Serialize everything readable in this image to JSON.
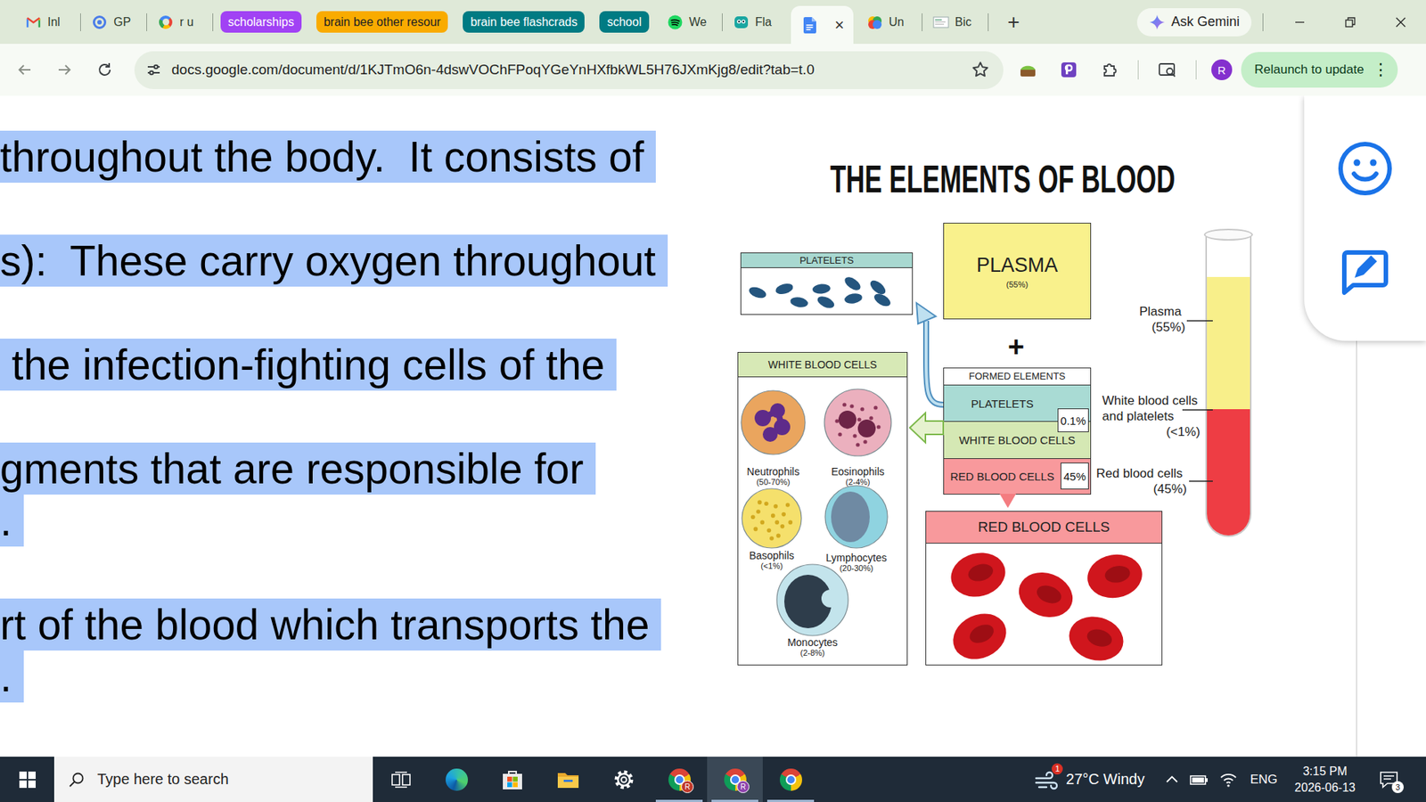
{
  "browser": {
    "tabs": [
      {
        "kind": "tab",
        "label": "Inl",
        "selected": false
      },
      {
        "kind": "tab",
        "label": "GP",
        "selected": false
      },
      {
        "kind": "tab",
        "label": "r u",
        "selected": false
      },
      {
        "kind": "group",
        "label": "scholarships",
        "color": "#a142f4"
      },
      {
        "kind": "group",
        "label": "brain bee other resour",
        "color": "#f9ab00"
      },
      {
        "kind": "group",
        "label": "brain bee flashcrads",
        "color": "#007b83"
      },
      {
        "kind": "group",
        "label": "school",
        "color": "#007b83"
      },
      {
        "kind": "tab",
        "label": "We",
        "selected": false
      },
      {
        "kind": "tab",
        "label": "Fla",
        "selected": false
      },
      {
        "kind": "tab",
        "close": "×",
        "selected": true
      },
      {
        "kind": "tab",
        "label": "Un",
        "selected": false
      },
      {
        "kind": "tab",
        "label": "Bic",
        "selected": false
      }
    ],
    "new_tab": "+",
    "gemini": "Ask Gemini",
    "url": "docs.google.com/document/d/1KJTmO6n-4dswVOChFPoqYGeYnHXfbkWL5H76JXmKjg8/edit?tab=t.0",
    "bookmarked": false,
    "profile": "R",
    "relaunch": "Relaunch to update",
    "menu": "⋮"
  },
  "doc": {
    "selected": true,
    "lines": [
      {
        "text": "throughout the body.  It consists of",
        "kind": "start"
      },
      {
        "text": "s):  These carry oxygen throughout",
        "kind": "start"
      },
      {
        "text": " the infection-fighting cells of the",
        "kind": "start"
      },
      {
        "text": "gments that are responsible for",
        "kind": "start"
      },
      {
        "text": ".",
        "kind": "wrap"
      },
      {
        "text": "rt of the blood which transports the",
        "kind": "start"
      },
      {
        "text": ".",
        "kind": "wrap"
      }
    ]
  },
  "diagram": {
    "title": "THE ELEMENTS OF BLOOD",
    "platelets": {
      "header": "PLATELETS"
    },
    "plasma": {
      "label": "PLASMA",
      "percent": "(55%)"
    },
    "plus": "+",
    "formed": {
      "header": "FORMED ELEMENTS",
      "rows": [
        {
          "label": "PLATELETS",
          "badge": "0.1%",
          "color": "#a9dbd4"
        },
        {
          "label": "WHITE BLOOD CELLS",
          "badge": "",
          "color": "#d5e8b4"
        },
        {
          "label": "RED BLOOD CELLS",
          "badge": "45%",
          "color": "#f8999c"
        }
      ]
    },
    "wbc": {
      "header": "WHITE BLOOD CELLS",
      "cells": [
        {
          "name": "Neutrophils",
          "percent": "(50-70%)",
          "color": "#eaa55e"
        },
        {
          "name": "Eosinophils",
          "percent": "(2-4%)",
          "color": "#ebb0be"
        },
        {
          "name": "Basophils",
          "percent": "(<1%)",
          "color": "#f5e06c"
        },
        {
          "name": "Lymphocytes",
          "percent": "(20-30%)",
          "color": "#8fd3e0"
        },
        {
          "name": "Monocytes",
          "percent": "(2-8%)",
          "color": "#c3e4ec"
        }
      ]
    },
    "rbc": {
      "header": "RED BLOOD CELLS"
    },
    "tube": {
      "layers": [
        {
          "color": "#f8ef8a",
          "level": 0.44
        },
        {
          "color": "#ee3d44",
          "level": 0.42
        }
      ],
      "labels": [
        {
          "lines": [
            "Plasma",
            "(55%)"
          ]
        },
        {
          "lines": [
            "White blood cells",
            "and platelets",
            "(<1%)"
          ]
        },
        {
          "lines": [
            "Red blood cells",
            "(45%)"
          ]
        }
      ]
    }
  },
  "taskbar": {
    "search": "Type here to search",
    "apps": [
      {
        "badge": "",
        "running": false,
        "selected": false
      },
      {
        "badge": "",
        "running": false,
        "selected": false
      },
      {
        "badge": "",
        "running": false,
        "selected": false
      },
      {
        "badge": "",
        "running": false,
        "selected": false
      },
      {
        "badge": "",
        "running": false,
        "selected": false
      },
      {
        "badge": "R",
        "running": true,
        "selected": false,
        "color": "#c0392b"
      },
      {
        "badge": "R",
        "running": true,
        "selected": true,
        "color": "#8e44ad"
      },
      {
        "badge": "",
        "running": true,
        "selected": false
      }
    ],
    "weather_badge": "1",
    "weather": "27°C Windy",
    "language": "ENG",
    "time": "3:15 PM",
    "date": "2026-06-13",
    "notifications": "3"
  }
}
